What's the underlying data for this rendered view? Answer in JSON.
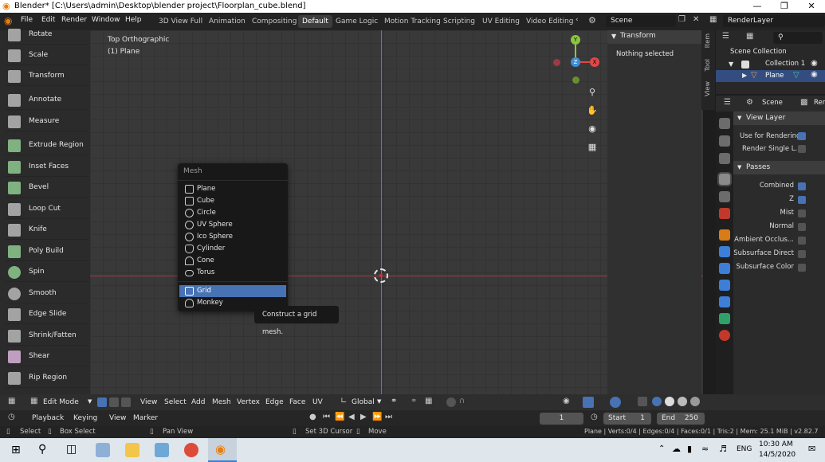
{
  "window": {
    "title": "Blender* [C:\\Users\\admin\\Desktop\\blender project\\Floorplan_cube.blend]"
  },
  "menubar": {
    "items": [
      "File",
      "Edit",
      "Render",
      "Window",
      "Help"
    ],
    "workspaces": [
      "3D View Full",
      "Animation",
      "Compositing",
      "Default",
      "Game Logic",
      "Motion Tracking",
      "Scripting",
      "UV Editing",
      "Video Editing"
    ],
    "active_workspace": "Default",
    "scene": "Scene",
    "renderlayer": "RenderLayer"
  },
  "toolbar": {
    "tools": [
      "Rotate",
      "Scale",
      "Transform",
      "Annotate",
      "Measure",
      "Extrude Region",
      "Inset Faces",
      "Bevel",
      "Loop Cut",
      "Knife",
      "Poly Build",
      "Spin",
      "Smooth",
      "Edge Slide",
      "Shrink/Fatten",
      "Shear",
      "Rip Region"
    ]
  },
  "viewport": {
    "view_name": "Top Orthographic",
    "object_name": "(1) Plane",
    "gizmo": {
      "y": "Y",
      "z": "Z",
      "x": "X"
    }
  },
  "npanel": {
    "title": "Transform",
    "content": "Nothing selected",
    "tabs": [
      "Item",
      "Tool",
      "View"
    ]
  },
  "add_menu": {
    "title": "Mesh",
    "items": [
      "Plane",
      "Cube",
      "Circle",
      "UV Sphere",
      "Ico Sphere",
      "Cylinder",
      "Cone",
      "Torus",
      "Grid",
      "Monkey"
    ],
    "selected": "Grid",
    "tooltip": "Construct a grid mesh."
  },
  "outliner": {
    "root": "Scene Collection",
    "collection": "Collection 1",
    "object": "Plane"
  },
  "properties": {
    "scene_tab": "Scene",
    "render_tab": "Rer",
    "view_layer": {
      "title": "View Layer",
      "use_for_rendering": "Use for Rendering",
      "render_single": "Render Single L..."
    },
    "passes": {
      "title": "Passes",
      "items": [
        {
          "label": "Combined",
          "on": true
        },
        {
          "label": "Z",
          "on": true
        },
        {
          "label": "Mist",
          "on": false
        },
        {
          "label": "Normal",
          "on": false
        },
        {
          "label": "Ambient Occlus...",
          "on": false
        },
        {
          "label": "Subsurface Direct",
          "on": false
        },
        {
          "label": "Subsurface Color",
          "on": false
        }
      ]
    }
  },
  "header3d": {
    "mode": "Edit Mode",
    "menus": [
      "View",
      "Select",
      "Add",
      "Mesh",
      "Vertex",
      "Edge",
      "Face",
      "UV"
    ],
    "orientation": "Global"
  },
  "timeline": {
    "menus": [
      "Playback",
      "Keying",
      "View",
      "Marker"
    ],
    "current_frame": "1",
    "start_label": "Start",
    "start": "1",
    "end_label": "End",
    "end": "250"
  },
  "status": {
    "select": "Select",
    "box_select": "Box Select",
    "pan": "Pan View",
    "cursor": "Set 3D Cursor",
    "move": "Move",
    "stats": "Plane | Verts:0/4 | Edges:0/4 | Faces:0/1 | Tris:2 | Mem: 25.1 MiB | v2.82.7"
  },
  "taskbar": {
    "time": "10:30 AM",
    "date": "14/5/2020",
    "lang": "ENG"
  }
}
